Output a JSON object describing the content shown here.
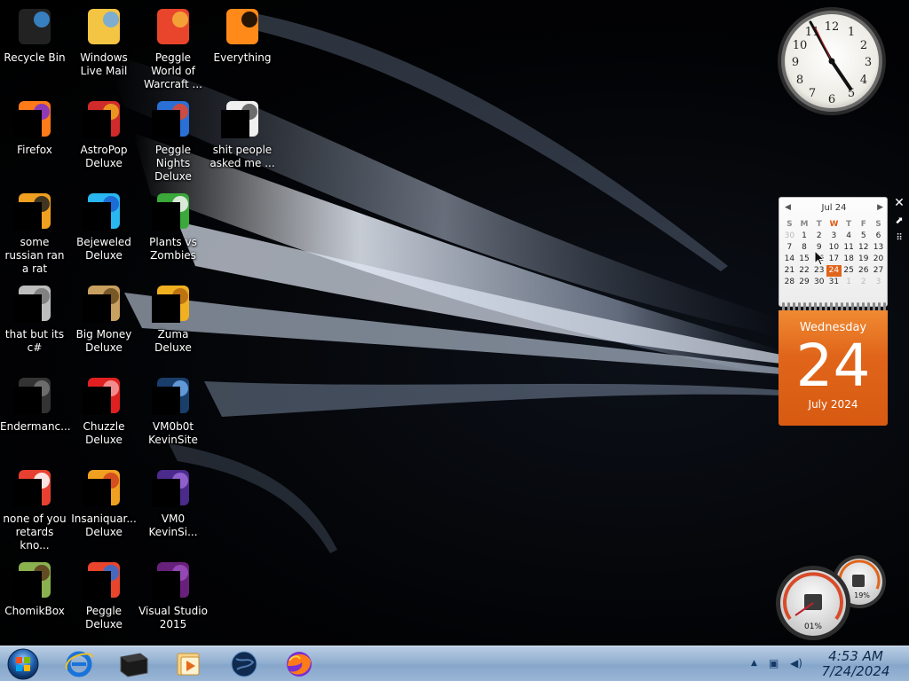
{
  "desktop": {
    "icons": [
      {
        "label": "Recycle Bin",
        "icon": "recycle-bin-icon"
      },
      {
        "label": "Windows Live Mail",
        "icon": "mail-icon"
      },
      {
        "label": "Peggle World of Warcraft ...",
        "icon": "peggle-icon"
      },
      {
        "label": "Everything",
        "icon": "everything-icon"
      },
      {
        "label": "Firefox",
        "icon": "firefox-icon"
      },
      {
        "label": "AstroPop Deluxe",
        "icon": "astropop-icon"
      },
      {
        "label": "Peggle Nights Deluxe",
        "icon": "peggle-nights-icon"
      },
      {
        "label": "shit people asked me ...",
        "icon": "folder-icon"
      },
      {
        "label": "some russian ran a rat",
        "icon": "file-icon"
      },
      {
        "label": "Bejeweled Deluxe",
        "icon": "bejeweled-icon"
      },
      {
        "label": "Plants vs Zombies",
        "icon": "plants-vs-zombies-icon"
      },
      {
        "label": "that but its c#",
        "icon": "windows-stack-icon"
      },
      {
        "label": "Big Money Deluxe",
        "icon": "money-bag-icon"
      },
      {
        "label": "Zuma Deluxe",
        "icon": "zuma-icon"
      },
      {
        "label": "Endermanc...",
        "icon": "terminal-icon"
      },
      {
        "label": "Chuzzle Deluxe",
        "icon": "chuzzle-icon"
      },
      {
        "label": "VM0b0t KevinSite",
        "icon": "vm-icon"
      },
      {
        "label": "none of you retards kno...",
        "icon": "shortcut-icon"
      },
      {
        "label": "Insaniquar... Deluxe",
        "icon": "fish-icon"
      },
      {
        "label": "VM0 KevinSi...",
        "icon": "document-icon"
      },
      {
        "label": "ChomikBox",
        "icon": "chomikbox-icon"
      },
      {
        "label": "Peggle Deluxe",
        "icon": "peggle-deluxe-icon"
      },
      {
        "label": "Visual Studio 2015",
        "icon": "visual-studio-icon"
      }
    ]
  },
  "calendar": {
    "month_label": "Jul 24",
    "weekday_headers": [
      "S",
      "M",
      "T",
      "W",
      "T",
      "F",
      "S"
    ],
    "weeks": [
      [
        "30",
        "1",
        "2",
        "3",
        "4",
        "5",
        "6"
      ],
      [
        "7",
        "8",
        "9",
        "10",
        "11",
        "12",
        "13"
      ],
      [
        "14",
        "15",
        "16",
        "17",
        "18",
        "19",
        "20"
      ],
      [
        "21",
        "22",
        "23",
        "24",
        "25",
        "26",
        "27"
      ],
      [
        "28",
        "29",
        "30",
        "31",
        "1",
        "2",
        "3"
      ]
    ],
    "weekday": "Wednesday",
    "day": "24",
    "month_year": "July 2024"
  },
  "meter": {
    "cpu": "01%",
    "memory": "19%"
  },
  "taskbar": {
    "pinned": [
      "internet-explorer-icon",
      "terminal-icon",
      "media-player-icon",
      "globe-icon",
      "firefox-icon"
    ],
    "time": "4:53 AM",
    "date": "7/24/2024"
  },
  "colors": {
    "accent": "#e0651a",
    "taskbar": "#93b0d1"
  }
}
